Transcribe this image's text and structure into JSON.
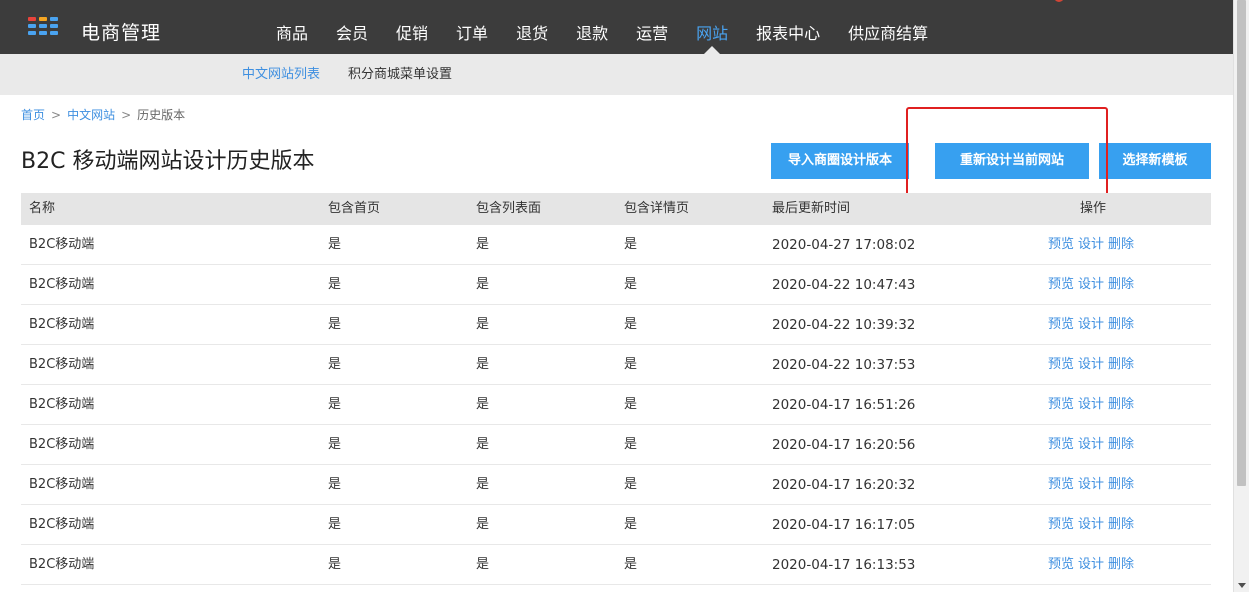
{
  "app": {
    "brand": "电商管理",
    "nav": [
      "商品",
      "会员",
      "促销",
      "订单",
      "退货",
      "退款",
      "运营",
      "网站",
      "报表中心",
      "供应商结算"
    ],
    "active_nav_index": 7
  },
  "subnav": [
    "中文网站列表",
    "积分商城菜单设置"
  ],
  "breadcrumb": {
    "home": "首页",
    "list": "中文网站",
    "current": "历史版本",
    "sep": ">"
  },
  "page_title": "B2C 移动端网站设计历史版本",
  "buttons": {
    "import": "导入商圈设计版本",
    "redesign": "重新设计当前网站",
    "template": "选择新模板"
  },
  "table": {
    "headers": {
      "name": "名称",
      "home": "包含首页",
      "list": "包含列表面",
      "detail": "包含详情页",
      "time": "最后更新时间",
      "op": "操作"
    },
    "op_labels": {
      "preview": "预览",
      "design": "设计",
      "delete": "删除"
    },
    "rows": [
      {
        "name": "B2C移动端",
        "home": "是",
        "list": "是",
        "detail": "是",
        "time": "2020-04-27 17:08:02"
      },
      {
        "name": "B2C移动端",
        "home": "是",
        "list": "是",
        "detail": "是",
        "time": "2020-04-22 10:47:43"
      },
      {
        "name": "B2C移动端",
        "home": "是",
        "list": "是",
        "detail": "是",
        "time": "2020-04-22 10:39:32"
      },
      {
        "name": "B2C移动端",
        "home": "是",
        "list": "是",
        "detail": "是",
        "time": "2020-04-22 10:37:53"
      },
      {
        "name": "B2C移动端",
        "home": "是",
        "list": "是",
        "detail": "是",
        "time": "2020-04-17 16:51:26"
      },
      {
        "name": "B2C移动端",
        "home": "是",
        "list": "是",
        "detail": "是",
        "time": "2020-04-17 16:20:56"
      },
      {
        "name": "B2C移动端",
        "home": "是",
        "list": "是",
        "detail": "是",
        "time": "2020-04-17 16:20:32"
      },
      {
        "name": "B2C移动端",
        "home": "是",
        "list": "是",
        "detail": "是",
        "time": "2020-04-17 16:17:05"
      },
      {
        "name": "B2C移动端",
        "home": "是",
        "list": "是",
        "detail": "是",
        "time": "2020-04-17 16:13:53"
      }
    ]
  },
  "colors": {
    "topbar": "#3c3c3c",
    "accent": "#37a0f0",
    "link": "#3e8fe0",
    "highlight": "#e02020"
  }
}
